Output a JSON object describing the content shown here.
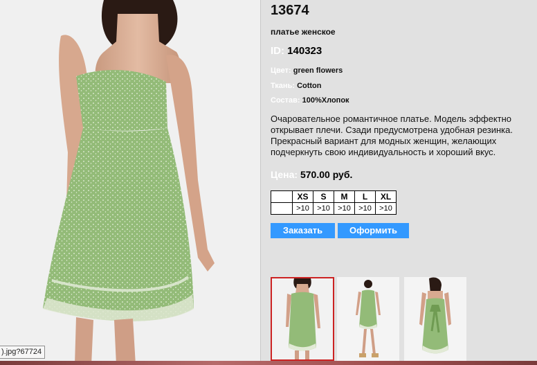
{
  "product": {
    "article_no": "13674",
    "type": "платье женское",
    "id_label": "ID:",
    "id_value": "140323",
    "color_label": "Цвет:",
    "color_value": "green flowers",
    "fabric_label": "Ткань:",
    "fabric_value": "Cotton",
    "composition_label": "Состав:",
    "composition_value": "100%Хлопок",
    "description": "Очаровательное романтичное платье. Модель эффектно открывает плечи. Сзади предусмотрена удобная  резинка. Прекрасный вариант для модных женщин, желающих подчеркнуть свою индивидуальность и хороший вкус.",
    "price_label": "Цена:",
    "price_value": "570.00 руб."
  },
  "sizes": {
    "headers": [
      "XS",
      "S",
      "M",
      "L",
      "XL"
    ],
    "stock": [
      ">10",
      ">10",
      ">10",
      ">10",
      ">10"
    ]
  },
  "actions": {
    "order_label": "Заказать",
    "checkout_label": "Оформить"
  },
  "status_tooltip": ").jpg?67724",
  "colors": {
    "accent": "#3399ff",
    "dress_green": "#93bb78",
    "background": "#e1e1e1",
    "selected_thumb_border": "#cc2222"
  }
}
